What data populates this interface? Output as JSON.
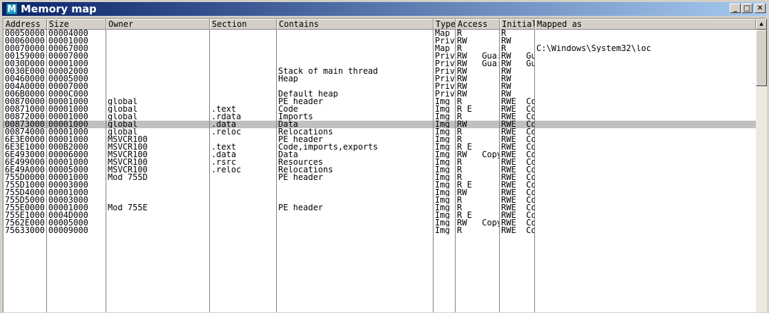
{
  "window": {
    "title": "Memory map",
    "icon_letter": "M",
    "icon_name": "memory-map-icon",
    "buttons": {
      "minimize": "_",
      "maximize": "□",
      "close": "✕"
    }
  },
  "columns": [
    "Address",
    "Size",
    "Owner",
    "Section",
    "Contains",
    "Type",
    "Access",
    "Initial",
    "Mapped as"
  ],
  "rows": [
    {
      "address": "00050000",
      "size": "00004000",
      "owner": "",
      "section": "",
      "contains": "",
      "type": "Map",
      "access": "R",
      "initial": "R",
      "mapped": ""
    },
    {
      "address": "00060000",
      "size": "00001000",
      "owner": "",
      "section": "",
      "contains": "",
      "type": "Priv",
      "access": "RW",
      "initial": "RW",
      "mapped": ""
    },
    {
      "address": "00070000",
      "size": "00067000",
      "owner": "",
      "section": "",
      "contains": "",
      "type": "Map",
      "access": "R",
      "initial": "R",
      "mapped": "C:\\Windows\\System32\\loc"
    },
    {
      "address": "00159000",
      "size": "00007000",
      "owner": "",
      "section": "",
      "contains": "",
      "type": "Priv",
      "access": "RW   Gua:",
      "initial": "RW   Gua:",
      "mapped": ""
    },
    {
      "address": "0030D000",
      "size": "00001000",
      "owner": "",
      "section": "",
      "contains": "",
      "type": "Priv",
      "access": "RW   Gua:",
      "initial": "RW   Gua:",
      "mapped": ""
    },
    {
      "address": "0030E000",
      "size": "00002000",
      "owner": "",
      "section": "",
      "contains": "Stack of main thread",
      "type": "Priv",
      "access": "RW",
      "initial": "RW",
      "mapped": ""
    },
    {
      "address": "00460000",
      "size": "00005000",
      "owner": "",
      "section": "",
      "contains": "Heap",
      "type": "Priv",
      "access": "RW",
      "initial": "RW",
      "mapped": ""
    },
    {
      "address": "004A0000",
      "size": "00007000",
      "owner": "",
      "section": "",
      "contains": "",
      "type": "Priv",
      "access": "RW",
      "initial": "RW",
      "mapped": ""
    },
    {
      "address": "006B0000",
      "size": "0000C000",
      "owner": "",
      "section": "",
      "contains": "Default heap",
      "type": "Priv",
      "access": "RW",
      "initial": "RW",
      "mapped": ""
    },
    {
      "address": "00870000",
      "size": "00001000",
      "owner": "global",
      "section": "",
      "contains": "PE header",
      "type": "Img",
      "access": "R",
      "initial": "RWE  Copy",
      "mapped": ""
    },
    {
      "address": "00871000",
      "size": "00001000",
      "owner": "global",
      "section": ".text",
      "contains": "Code",
      "type": "Img",
      "access": "R E",
      "initial": "RWE  Copy",
      "mapped": ""
    },
    {
      "address": "00872000",
      "size": "00001000",
      "owner": "global",
      "section": ".rdata",
      "contains": "Imports",
      "type": "Img",
      "access": "R",
      "initial": "RWE  Copy",
      "mapped": ""
    },
    {
      "address": "00873000",
      "size": "00001000",
      "owner": "global",
      "section": ".data",
      "contains": "Data",
      "type": "Img",
      "access": "RW",
      "initial": "RWE  Copy",
      "mapped": "",
      "selected": true
    },
    {
      "address": "00874000",
      "size": "00001000",
      "owner": "global",
      "section": ".reloc",
      "contains": "Relocations",
      "type": "Img",
      "access": "R",
      "initial": "RWE  Copy",
      "mapped": ""
    },
    {
      "address": "6E3E0000",
      "size": "00001000",
      "owner": "MSVCR100",
      "section": "",
      "contains": "PE header",
      "type": "Img",
      "access": "R",
      "initial": "RWE  Copy",
      "mapped": ""
    },
    {
      "address": "6E3E1000",
      "size": "000B2000",
      "owner": "MSVCR100",
      "section": ".text",
      "contains": "Code,imports,exports",
      "type": "Img",
      "access": "R E",
      "initial": "RWE  Copy",
      "mapped": ""
    },
    {
      "address": "6E493000",
      "size": "00006000",
      "owner": "MSVCR100",
      "section": ".data",
      "contains": "Data",
      "type": "Img",
      "access": "RW   Copy",
      "initial": "RWE  Copy",
      "mapped": ""
    },
    {
      "address": "6E499000",
      "size": "00001000",
      "owner": "MSVCR100",
      "section": ".rsrc",
      "contains": "Resources",
      "type": "Img",
      "access": "R",
      "initial": "RWE  Copy",
      "mapped": ""
    },
    {
      "address": "6E49A000",
      "size": "00005000",
      "owner": "MSVCR100",
      "section": ".reloc",
      "contains": "Relocations",
      "type": "Img",
      "access": "R",
      "initial": "RWE  Copy",
      "mapped": ""
    },
    {
      "address": "755D0000",
      "size": "00001000",
      "owner": "Mod_755D",
      "section": "",
      "contains": "PE header",
      "type": "Img",
      "access": "R",
      "initial": "RWE  Copy",
      "mapped": ""
    },
    {
      "address": "755D1000",
      "size": "00003000",
      "owner": "",
      "section": "",
      "contains": "",
      "type": "Img",
      "access": "R E",
      "initial": "RWE  Copy",
      "mapped": ""
    },
    {
      "address": "755D4000",
      "size": "00001000",
      "owner": "",
      "section": "",
      "contains": "",
      "type": "Img",
      "access": "RW",
      "initial": "RWE  Copy",
      "mapped": ""
    },
    {
      "address": "755D5000",
      "size": "00003000",
      "owner": "",
      "section": "",
      "contains": "",
      "type": "Img",
      "access": "R",
      "initial": "RWE  Copy",
      "mapped": ""
    },
    {
      "address": "755E0000",
      "size": "00001000",
      "owner": "Mod_755E",
      "section": "",
      "contains": "PE header",
      "type": "Img",
      "access": "R",
      "initial": "RWE  Copy",
      "mapped": ""
    },
    {
      "address": "755E1000",
      "size": "0004D000",
      "owner": "",
      "section": "",
      "contains": "",
      "type": "Img",
      "access": "R E",
      "initial": "RWE  Copy",
      "mapped": ""
    },
    {
      "address": "7562E000",
      "size": "00005000",
      "owner": "",
      "section": "",
      "contains": "",
      "type": "Img",
      "access": "RW   Copy",
      "initial": "RWE  Copy",
      "mapped": ""
    },
    {
      "address": "75633000",
      "size": "00009000",
      "owner": "",
      "section": "",
      "contains": "",
      "type": "Img",
      "access": "R",
      "initial": "RWE  Copy",
      "mapped": ""
    }
  ]
}
